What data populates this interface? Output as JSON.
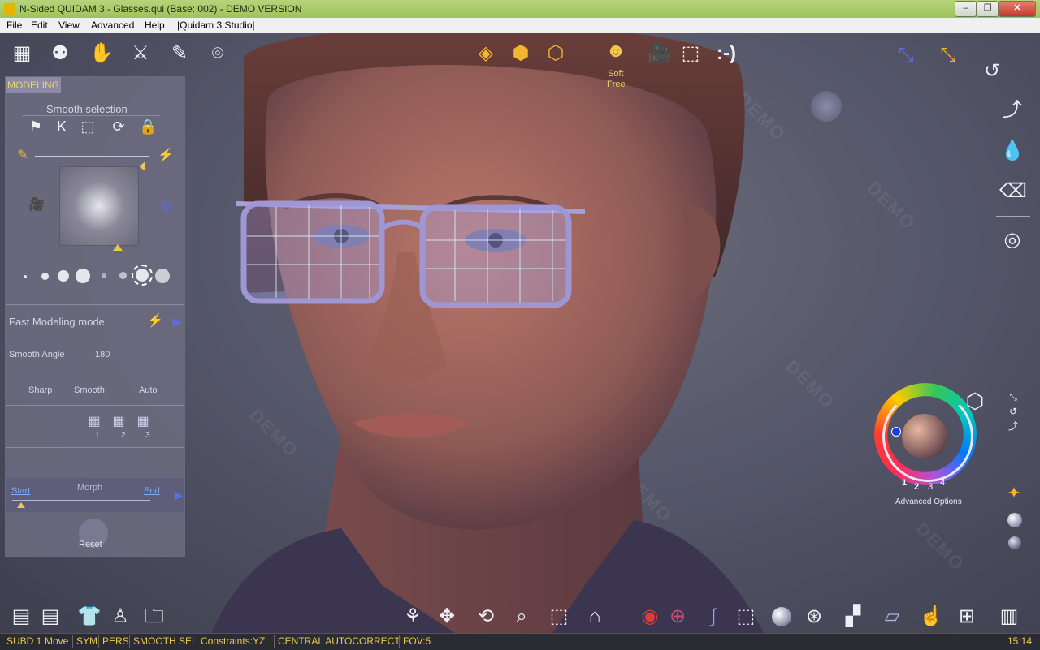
{
  "window": {
    "title": "N-Sided QUIDAM 3 - Glasses.qui (Base: 002) - DEMO VERSION",
    "minimize": "–",
    "restore": "❐",
    "close": "✕"
  },
  "menu": [
    "File",
    "Edit",
    "View",
    "Advanced",
    "Help",
    "|Quidam 3 Studio|"
  ],
  "top_toolbar": {
    "soft_label": "Soft",
    "free_label": "Free",
    "smiley_label": ":-)"
  },
  "watermark": "DEMO",
  "left_panel": {
    "title": "MODELING",
    "smooth_selection": "Smooth selection",
    "fast_modeling": "Fast Modeling mode",
    "smooth_angle_label": "Smooth Angle",
    "smooth_angle_value": "180",
    "sharp": "Sharp",
    "smooth": "Smooth",
    "auto": "Auto",
    "subdiv": [
      "1",
      "2",
      "3"
    ],
    "morph": "Morph",
    "start": "Start",
    "end": "End",
    "reset": "Reset"
  },
  "color_picker": {
    "numbers": [
      "1",
      "2",
      "3",
      "4"
    ],
    "advanced_options": "Advanced Options"
  },
  "status": {
    "items": [
      "SUBD 1",
      "Move",
      "SYM",
      "PERS",
      "SMOOTH SEL",
      "Constraints:YZ",
      "CENTRAL AUTOCORRECT",
      "FOV:5"
    ],
    "time": "15:14"
  },
  "colors": {
    "accent_gold": "#e8c94e",
    "panel": "#6e6c80",
    "skin": "#a86b58"
  }
}
